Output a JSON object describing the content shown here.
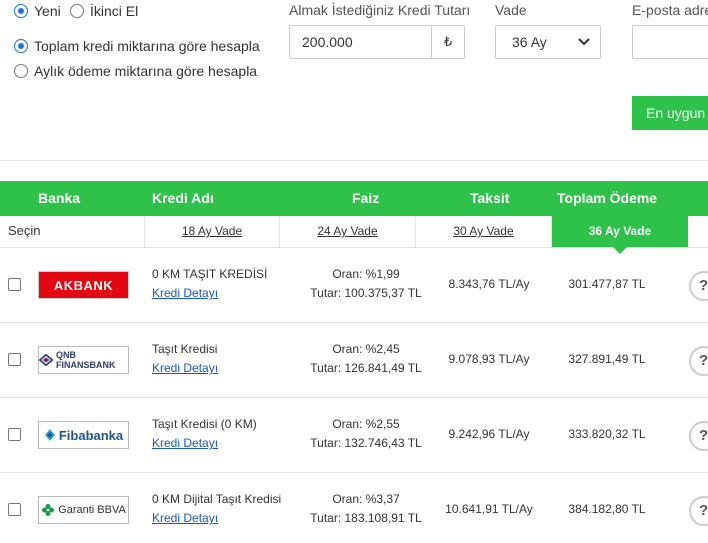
{
  "form": {
    "condition_options": [
      {
        "label": "Yeni",
        "selected": true
      },
      {
        "label": "İkinci El",
        "selected": false
      }
    ],
    "calc_options": [
      {
        "label": "Toplam kredi miktarına göre hesapla",
        "selected": true
      },
      {
        "label": "Aylık ödeme miktarına göre hesapla",
        "selected": false
      }
    ],
    "amount_label": "Almak İstediğiniz Kredi Tutarı",
    "amount_value": "200.000",
    "currency": "₺",
    "term_label": "Vade",
    "term_value": "36 Ay",
    "email_label": "E-posta adre",
    "cta_label": "En uygun"
  },
  "table": {
    "headers": {
      "bank": "Banka",
      "loan": "Kredi Adı",
      "rate": "Faiz",
      "installment": "Taksit",
      "total": "Toplam Ödeme"
    },
    "select_label": "Seçin",
    "term_tabs": [
      {
        "label": "18 Ay Vade",
        "active": false
      },
      {
        "label": "24 Ay Vade",
        "active": false
      },
      {
        "label": "30 Ay Vade",
        "active": false
      },
      {
        "label": "36 Ay Vade",
        "active": true
      }
    ],
    "rows": [
      {
        "bank": "AKBANK",
        "loan_name": "0 KM TAŞIT KREDİSİ",
        "detail": "Kredi Detayı",
        "rate": "Oran: %1,99",
        "total_amount": "Tutar: 100.375,37 TL",
        "installment": "8.343,76 TL/Ay",
        "total_payment": "301.477,87 TL"
      },
      {
        "bank": "QNB FINANSBANK",
        "loan_name": "Taşıt Kredisi",
        "detail": "Kredi Detayı",
        "rate": "Oran: %2,45",
        "total_amount": "Tutar: 126.841,49 TL",
        "installment": "9.078,93 TL/Ay",
        "total_payment": "327.891,49 TL"
      },
      {
        "bank": "Fibabanka",
        "loan_name": "Taşıt Kredisi (0 KM)",
        "detail": "Kredi Detayı",
        "rate": "Oran: %2,55",
        "total_amount": "Tutar: 132.746,43 TL",
        "installment": "9.242,96 TL/Ay",
        "total_payment": "333.820,32 TL"
      },
      {
        "bank": "Garanti BBVA",
        "loan_name": "0 KM Dijital Taşıt Kredisi",
        "detail": "Kredi Detayı",
        "rate": "Oran: %3,37",
        "total_amount": "Tutar: 183.108,91 TL",
        "installment": "10.641,91 TL/Ay",
        "total_payment": "384.182,80 TL"
      }
    ],
    "help_icon": "?"
  },
  "colors": {
    "accent": "#2ec24a",
    "link": "#1a56c7",
    "akbank": "#e30613"
  }
}
